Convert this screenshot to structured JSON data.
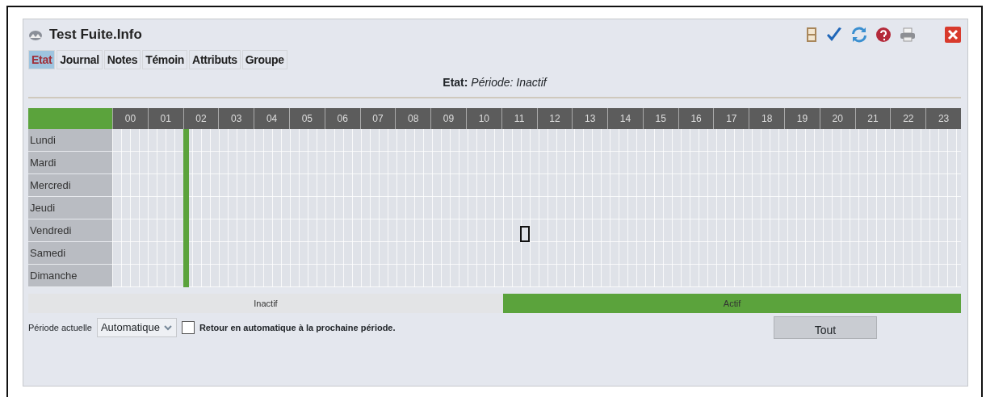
{
  "window": {
    "title": "Test Fuite.Info"
  },
  "tabs": [
    {
      "label": "Etat",
      "selected": true
    },
    {
      "label": "Journal",
      "selected": false
    },
    {
      "label": "Notes",
      "selected": false
    },
    {
      "label": "Témoin",
      "selected": false
    },
    {
      "label": "Attributs",
      "selected": false
    },
    {
      "label": "Groupe",
      "selected": false
    }
  ],
  "status": {
    "label": "Etat:",
    "value": "Période: Inactif"
  },
  "schedule": {
    "hours": [
      {
        "label": "00",
        "marked": false
      },
      {
        "label": "01",
        "marked": false
      },
      {
        "label": "02",
        "marked": true
      },
      {
        "label": "03",
        "marked": false
      },
      {
        "label": "04",
        "marked": false
      },
      {
        "label": "05",
        "marked": false
      },
      {
        "label": "06",
        "marked": false
      },
      {
        "label": "07",
        "marked": false
      },
      {
        "label": "08",
        "marked": false
      },
      {
        "label": "09",
        "marked": false
      },
      {
        "label": "10",
        "marked": false
      },
      {
        "label": "11",
        "marked": false
      },
      {
        "label": "12",
        "marked": false
      },
      {
        "label": "13",
        "marked": false
      },
      {
        "label": "14",
        "marked": false
      },
      {
        "label": "15",
        "marked": false
      },
      {
        "label": "16",
        "marked": false
      },
      {
        "label": "17",
        "marked": false
      },
      {
        "label": "18",
        "marked": false
      },
      {
        "label": "19",
        "marked": false
      },
      {
        "label": "20",
        "marked": false
      },
      {
        "label": "21",
        "marked": false
      },
      {
        "label": "22",
        "marked": false
      },
      {
        "label": "23",
        "marked": false
      }
    ],
    "days": [
      "Lundi",
      "Mardi",
      "Mercredi",
      "Jeudi",
      "Vendredi",
      "Samedi",
      "Dimanche"
    ]
  },
  "legend": [
    {
      "label": "Inactif",
      "color": "#e3e4e6"
    },
    {
      "label": "Actif",
      "color": "#5ba33c"
    }
  ],
  "period": {
    "label": "Période actuelle",
    "value": "Automatique"
  },
  "auto_return": {
    "label": "Retour en automatique à la prochaine période.",
    "checked": false
  },
  "buttons": [
    "Tout"
  ]
}
